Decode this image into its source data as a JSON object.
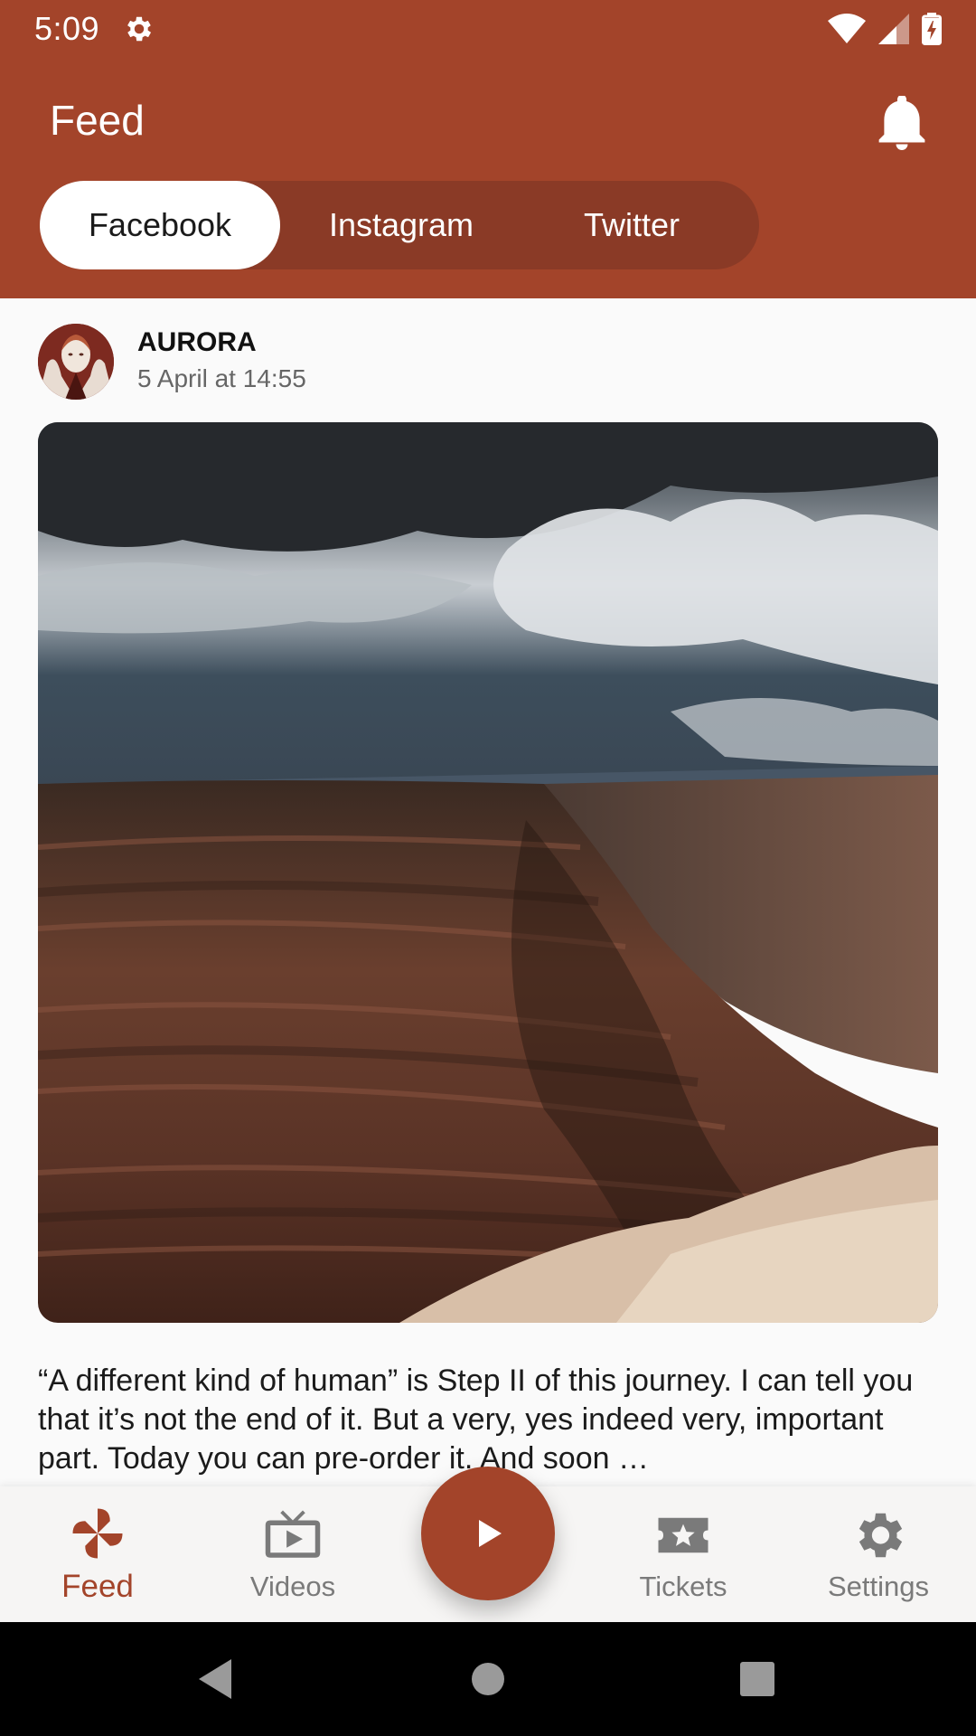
{
  "status_bar": {
    "time": "5:09"
  },
  "app_bar": {
    "title": "Feed"
  },
  "tabs": [
    {
      "label": "Facebook",
      "active": true
    },
    {
      "label": "Instagram",
      "active": false
    },
    {
      "label": "Twitter",
      "active": false
    }
  ],
  "post": {
    "author": "AURORA",
    "timestamp": "5 April at 14:55",
    "text": "“A different kind of human” is Step II of this journey.  I can tell you that it’s not the end of it. But a very, yes indeed very, important part. Today you can pre-order it. And soon …"
  },
  "bottom_nav": {
    "items": [
      {
        "label": "Feed",
        "icon": "pinwheel-icon",
        "active": true
      },
      {
        "label": "Videos",
        "icon": "tv-play-icon",
        "active": false
      },
      {
        "label": "Tickets",
        "icon": "ticket-star-icon",
        "active": false
      },
      {
        "label": "Settings",
        "icon": "gear-icon",
        "active": false
      }
    ],
    "center_button_icon": "play-icon"
  },
  "colors": {
    "brand": "#a3442a",
    "segment_track": "#8a3a26",
    "inactive_nav": "#7a7a7a"
  }
}
